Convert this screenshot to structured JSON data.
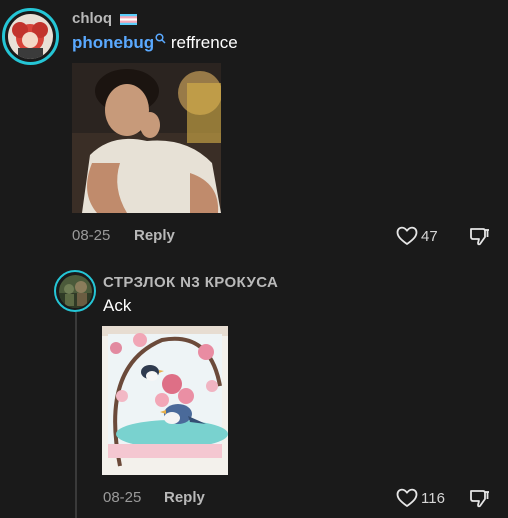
{
  "comment": {
    "username": "chloq",
    "mention": "phonebug",
    "text": "reffrence",
    "date": "08-25",
    "reply_label": "Reply",
    "likes": "47"
  },
  "reply": {
    "username": "СТРЗЛОК N3 КРОКУСА",
    "text": "Ack",
    "date": "08-25",
    "reply_label": "Reply",
    "likes": "116"
  },
  "colors": {
    "background": "#1a1a1a",
    "mention": "#5aa9ff",
    "avatar_ring": "#25c6d6"
  },
  "icons": [
    "heart-icon",
    "dislike-icon",
    "search-mention-icon",
    "trans-flag-icon"
  ]
}
